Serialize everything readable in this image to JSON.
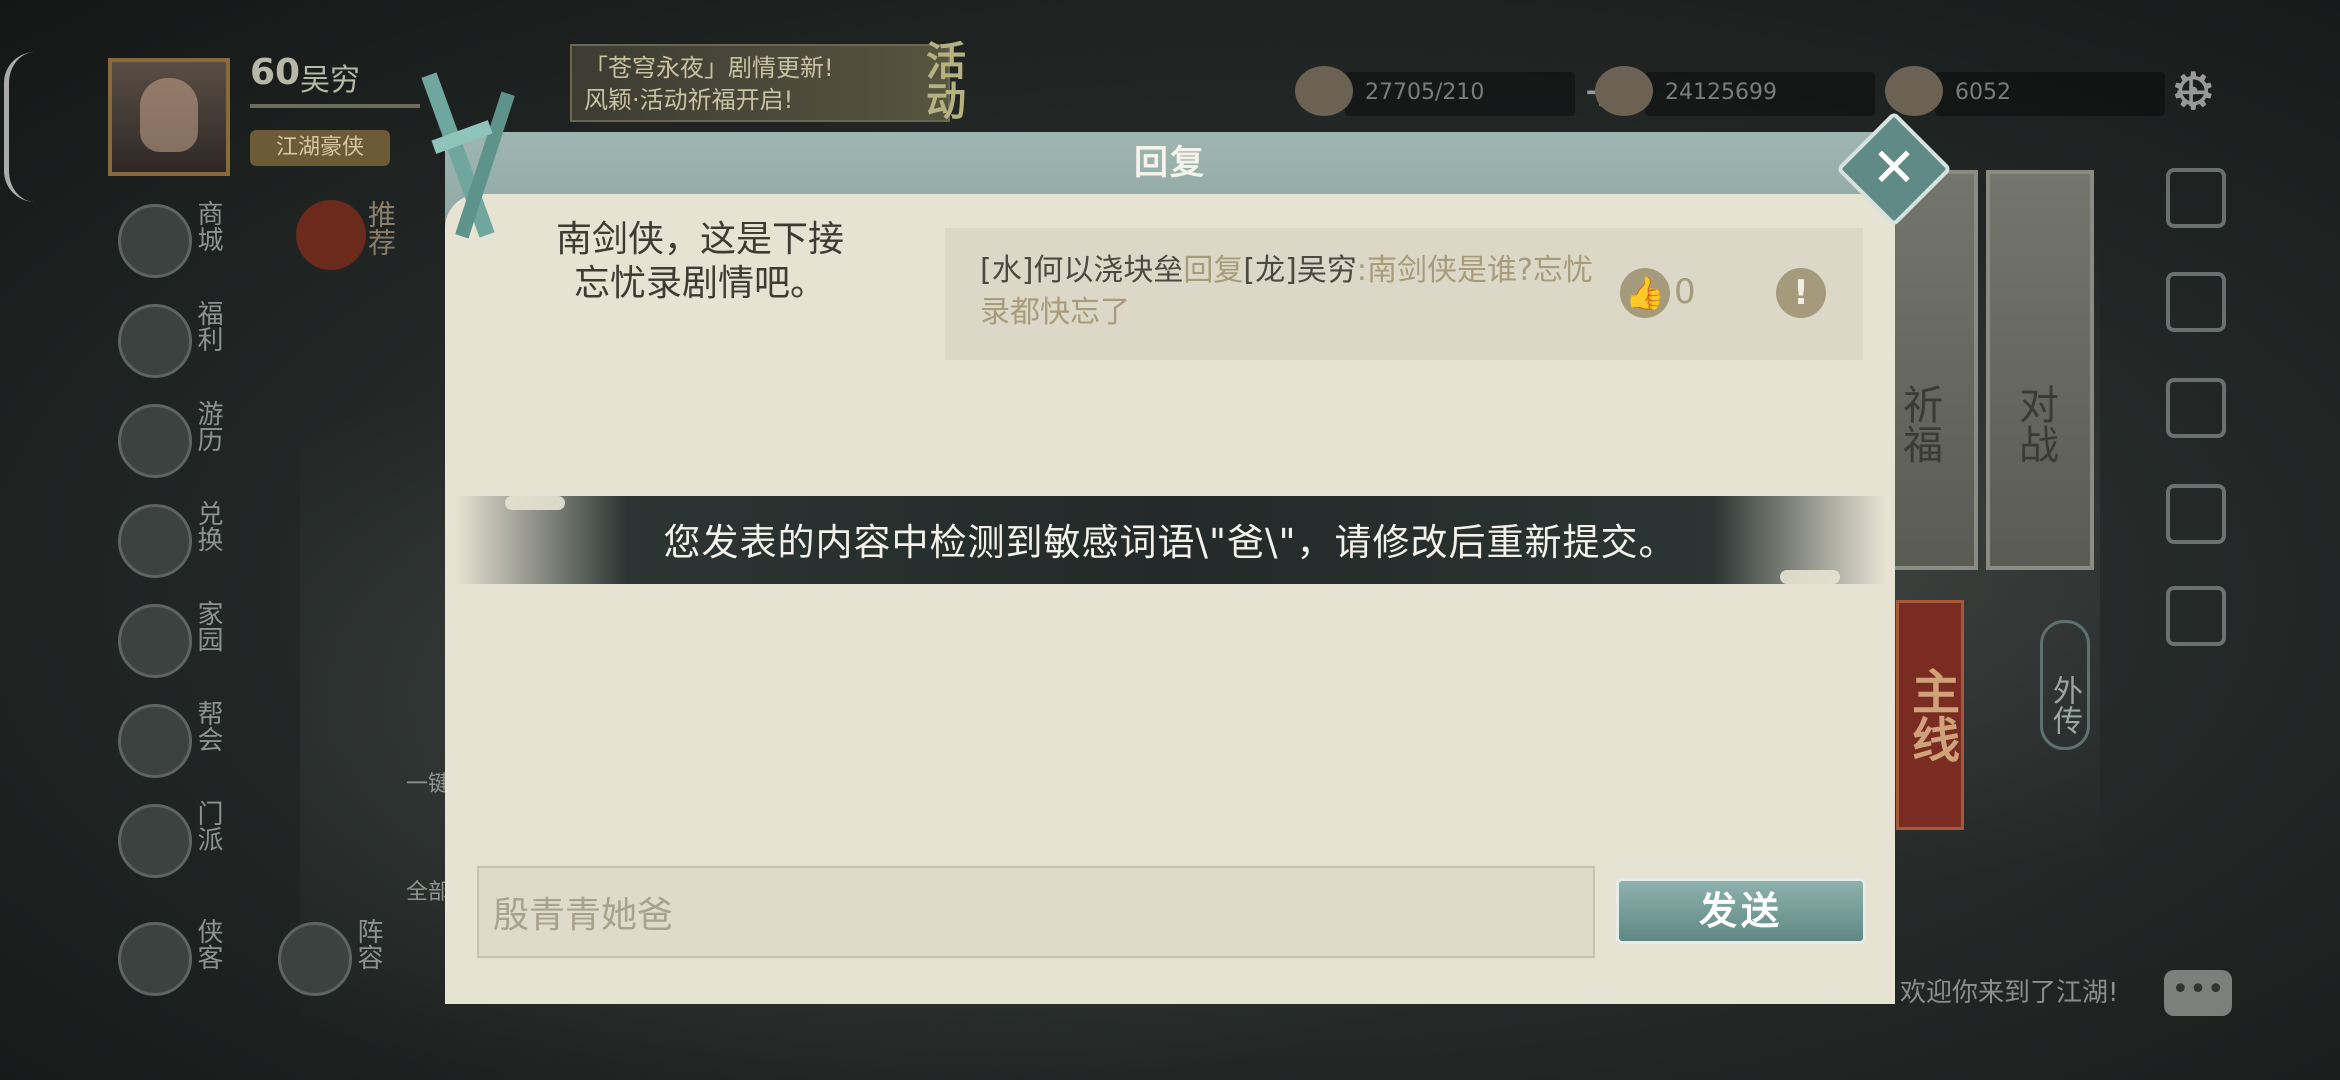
{
  "hud": {
    "level": "60",
    "player_name": "吴穷",
    "title_badge": "江湖豪侠",
    "recommend_label": "推荐",
    "banner_line1": "「苍穹永夜」剧情更新!",
    "banner_line2": "风颖·活动祈福开启!",
    "activity_label": "活动",
    "currencies": [
      {
        "icon": "silver-coins-icon",
        "value": "27705/210"
      },
      {
        "icon": "copper-coins-icon",
        "value": "24125699"
      },
      {
        "icon": "gold-ingot-icon",
        "value": "6052"
      }
    ],
    "left_menu": [
      {
        "label": "商城",
        "icon": "shop-icon"
      },
      {
        "label": "福利",
        "icon": "welfare-icon"
      },
      {
        "label": "游历",
        "icon": "horse-icon"
      },
      {
        "label": "兑换",
        "icon": "exchange-icon"
      },
      {
        "label": "家园",
        "icon": "home-icon"
      },
      {
        "label": "帮会",
        "icon": "guild-icon"
      },
      {
        "label": "门派",
        "icon": "sect-icon"
      }
    ],
    "bottom_left": [
      {
        "label": "侠客",
        "icon": "hero-icon"
      },
      {
        "label": "阵容",
        "icon": "formation-icon"
      }
    ],
    "side_text_1": "一键",
    "side_text_2": "全部",
    "scroll_1": "祈福",
    "scroll_2": "对战",
    "mainline": "主线",
    "waizhuan": "外传",
    "welcome": "欢迎你来到了江湖!",
    "chat_icon": "chat-bubble-icon"
  },
  "dialog": {
    "title": "回复",
    "original_post_line1": "南剑侠，这是下接",
    "original_post_line2": "忘忧录剧情吧。",
    "reply": {
      "from": "[水]何以浇块垒",
      "verb": "回复",
      "to": "[龙]吴穷",
      "content": ":南剑侠是谁?忘忧录都快忘了",
      "likes": "0"
    },
    "toast": "您发表的内容中检测到敏感词语\\\"爸\\\"，请修改后重新提交。",
    "input_value": "殷青青她爸",
    "send_label": "发送",
    "close_icon": "close-icon",
    "like_icon": "thumbs-up-icon",
    "report_icon": "report-icon"
  }
}
